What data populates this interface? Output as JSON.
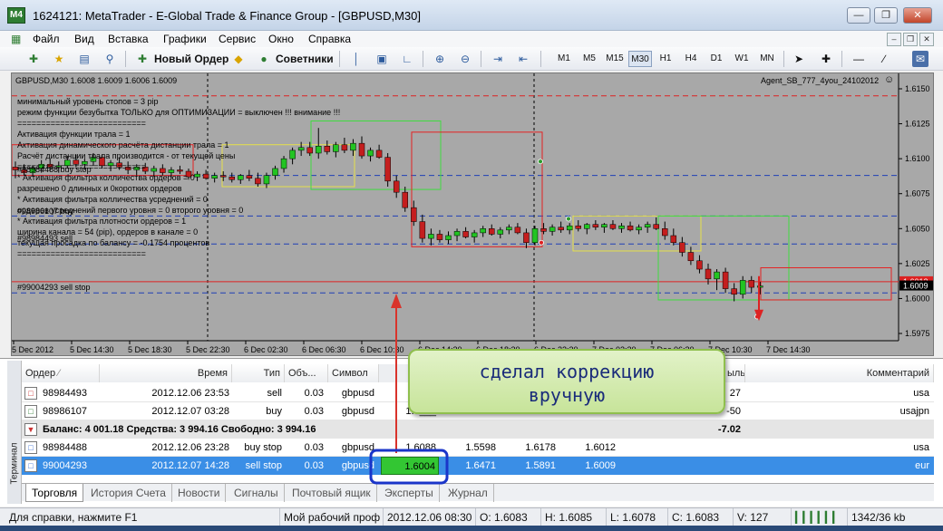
{
  "window": {
    "title": "1624121: MetaTrader - E-Global Trade & Finance Group - [GBPUSD,M30]",
    "logo": "M4"
  },
  "menu": [
    "Файл",
    "Вид",
    "Вставка",
    "Графики",
    "Сервис",
    "Окно",
    "Справка"
  ],
  "toolbar": {
    "new_order": "Новый Ордер",
    "advisors": "Советники",
    "timeframes": [
      "M1",
      "M5",
      "M15",
      "M30",
      "H1",
      "H4",
      "D1",
      "W1",
      "MN"
    ],
    "active_timeframe": "M30"
  },
  "chart": {
    "header": "GBPUSD,M30  1.6008 1.6009 1.6006 1.6009",
    "expert": "Agent_SB_777_4you_24102012",
    "info_lines": [
      "минимальный уровень стопов = 3 pip",
      "режим функции безубытка ТОЛЬКО для ОПТИМИЗАЦИИ = выключен !!! внимание !!!",
      "===========================",
      "Активация функции трала = 1",
      "Активация динамического расчёта дистанции трала = 1",
      "Расчёт дистанции трала производится - от текущей цены",
      "===========================",
      "* Активация фильтра колличества ордеров = 0",
      "разрешено 0 длинных и 0коротких ордеров",
      "* Активация фильтра колличества усреднений = 0",
      "ордеров усреднений первого уровня = 0 второго уровня = 0",
      "* Активация фильтра плотности ордеров = 1",
      "ширина канала = 54 (pip), ордеров в канале = 0",
      "текущая просадка по балансу = -0.1754 процентов",
      "==========================="
    ],
    "line_labels": [
      "#98984488 buy stop",
      "#98986107 buy",
      "#98984493 sell",
      "#99004293 sell stop"
    ],
    "current_price": "1.6009",
    "red_price": "1.6012",
    "y_ticks": [
      "1.6150",
      "1.6125",
      "1.6100",
      "1.6075",
      "1.6050",
      "1.6025",
      "1.6000",
      "1.5975"
    ],
    "x_ticks": [
      "5 Dec 2012",
      "5 Dec 14:30",
      "5 Dec 18:30",
      "5 Dec 22:30",
      "6 Dec 02:30",
      "6 Dec 06:30",
      "6 Dec 10:30",
      "6 Dec 14:30",
      "6 Dec 18:30",
      "6 Dec 22:30",
      "7 Dec 02:30",
      "7 Dec 06:30",
      "7 Dec 10:30",
      "7 Dec 14:30"
    ]
  },
  "callout": {
    "text": "сделал коррекцию\nвручную"
  },
  "terminal": {
    "side_label": "Терминал",
    "headers": {
      "order": "Ордер",
      "time": "Время",
      "type": "Тип",
      "volume": "Объ...",
      "symbol": "Символ",
      "profit_partial": "ыль",
      "comment": "Комментарий"
    },
    "rows": [
      {
        "order": "98984493",
        "time": "2012.12.06 23:53",
        "type": "sell",
        "volume": "0.03",
        "symbol": "gbpusd",
        "profit": "27",
        "comment": "usa"
      },
      {
        "order": "98986107",
        "time": "2012.12.07 03:28",
        "type": "buy",
        "volume": "0.03",
        "symbol": "gbpusd",
        "price_partial": "1.6___",
        "profit": "-50",
        "comment": "usajpn"
      }
    ],
    "balance": {
      "text": "Баланс: 4 001.18  Средства: 3 994.16  Свободно: 3 994.16",
      "profit": "-7.02"
    },
    "pending": [
      {
        "order": "98984488",
        "time": "2012.12.06 23:28",
        "type": "buy stop",
        "volume": "0.03",
        "symbol": "gbpusd",
        "price": "1.6088",
        "sl": "1.5598",
        "tp": "1.6178",
        "current": "1.6012",
        "comment": "usa"
      },
      {
        "order": "99004293",
        "time": "2012.12.07 14:28",
        "type": "sell stop",
        "volume": "0.03",
        "symbol": "gbpusd",
        "price": "1.6004",
        "sl": "1.6471",
        "tp": "1.5891",
        "current": "1.6009",
        "comment": "eur"
      }
    ],
    "tabs": [
      "Торговля",
      "История Счета",
      "Новости",
      "Сигналы",
      "Почтовый ящик",
      "Эксперты",
      "Журнал"
    ]
  },
  "status": {
    "help": "Для справки, нажмите F1",
    "profile": "Мой рабочий проф",
    "time": "2012.12.06 08:30",
    "open": "O: 1.6083",
    "high": "H: 1.6085",
    "low": "L: 1.6078",
    "close": "C: 1.6083",
    "volume": "V: 127",
    "traffic": "1342/36 kb"
  },
  "colors": {
    "accent_blue": "#2f6fd6",
    "selected_row": "#3a8ee6",
    "highlight_green": "#33c633",
    "callout_border": "#8fbf4d"
  }
}
